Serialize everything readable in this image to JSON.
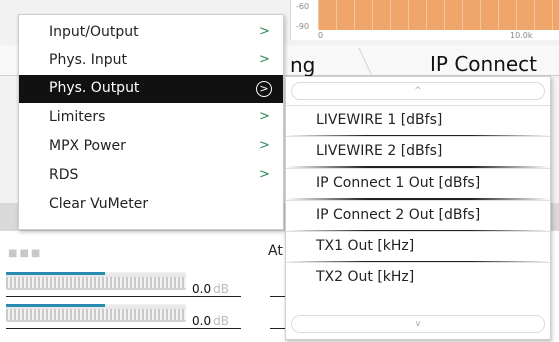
{
  "graph": {
    "tick_top": "-60",
    "tick_mid": "-90",
    "tick_x0": "0",
    "tick_x1": "10.0k"
  },
  "tabs": {
    "tab_partial": "ng",
    "tab_ip_connect": "IP Connect"
  },
  "panel": {
    "at_label": "At",
    "meters": [
      {
        "value": "0.0",
        "unit": "dB",
        "level_percent": 55
      },
      {
        "value": "0.0",
        "unit": "dB",
        "level_percent": 55
      }
    ]
  },
  "menu": {
    "items": [
      {
        "label": "Input/Output",
        "has_submenu": true,
        "arrow": ">"
      },
      {
        "label": "Phys. Input",
        "has_submenu": true,
        "arrow": ">"
      },
      {
        "label": "Phys. Output",
        "has_submenu": true,
        "arrow": ">",
        "active": true
      },
      {
        "label": "Limiters",
        "has_submenu": true,
        "arrow": ">"
      },
      {
        "label": "MPX Power",
        "has_submenu": true,
        "arrow": ">"
      },
      {
        "label": "RDS",
        "has_submenu": true,
        "arrow": ">"
      },
      {
        "label": "Clear VuMeter",
        "has_submenu": false,
        "arrow": ""
      }
    ]
  },
  "submenu": {
    "scroll_up": "^",
    "scroll_down": "v",
    "items": [
      {
        "label": "LIVEWIRE 1 [dBfs]"
      },
      {
        "label": "LIVEWIRE 2 [dBfs]"
      },
      {
        "label": "IP Connect 1 Out [dBfs]"
      },
      {
        "label": "IP Connect 2 Out [dBfs]"
      },
      {
        "label": "TX1 Out [kHz]"
      },
      {
        "label": "TX2 Out [kHz]"
      }
    ]
  },
  "colors": {
    "graph_fill": "#f0a66b",
    "meter_blue": "#2a8db0",
    "arrow_green": "#2e8b57",
    "active_bg": "#111111"
  }
}
